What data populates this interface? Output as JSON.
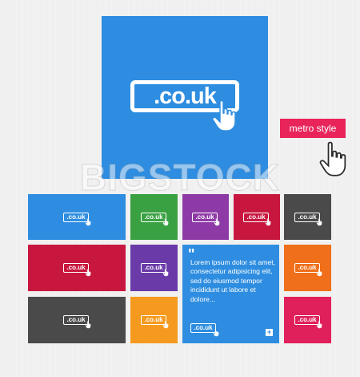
{
  "main": {
    "big_tile": {
      "label": ".co.uk",
      "color": "#2e8de0"
    },
    "metro_button": {
      "label": "metro style",
      "color": "#e8245a"
    },
    "watermark": "BIGSTOCK",
    "text_tile": {
      "quote": "\"",
      "body": "Lorem ipsum dolor sit amet, consectetur adipisicing elit, sed do eiusmod tempor incididunt ut labore et dolore...",
      "badge": ".co.uk",
      "plus": "+",
      "color": "#2e8de0"
    },
    "tiles": [
      {
        "label": ".co.uk",
        "color": "#2e8de0"
      },
      {
        "label": ".co.uk",
        "color": "#3aa142"
      },
      {
        "label": ".co.uk",
        "color": "#8e3aa6"
      },
      {
        "label": ".co.uk",
        "color": "#c8173f"
      },
      {
        "label": ".co.uk",
        "color": "#4a4a4a"
      },
      {
        "label": ".co.uk",
        "color": "#c8173f"
      },
      {
        "label": ".co.uk",
        "color": "#6a3aa8"
      },
      {
        "label": ".co.uk",
        "color": "#ef6f1a"
      },
      {
        "label": ".co.uk",
        "color": "#4a4a4a"
      },
      {
        "label": ".co.uk",
        "color": "#f59a1e"
      },
      {
        "label": ".co.uk",
        "color": "#e0205a"
      }
    ]
  }
}
